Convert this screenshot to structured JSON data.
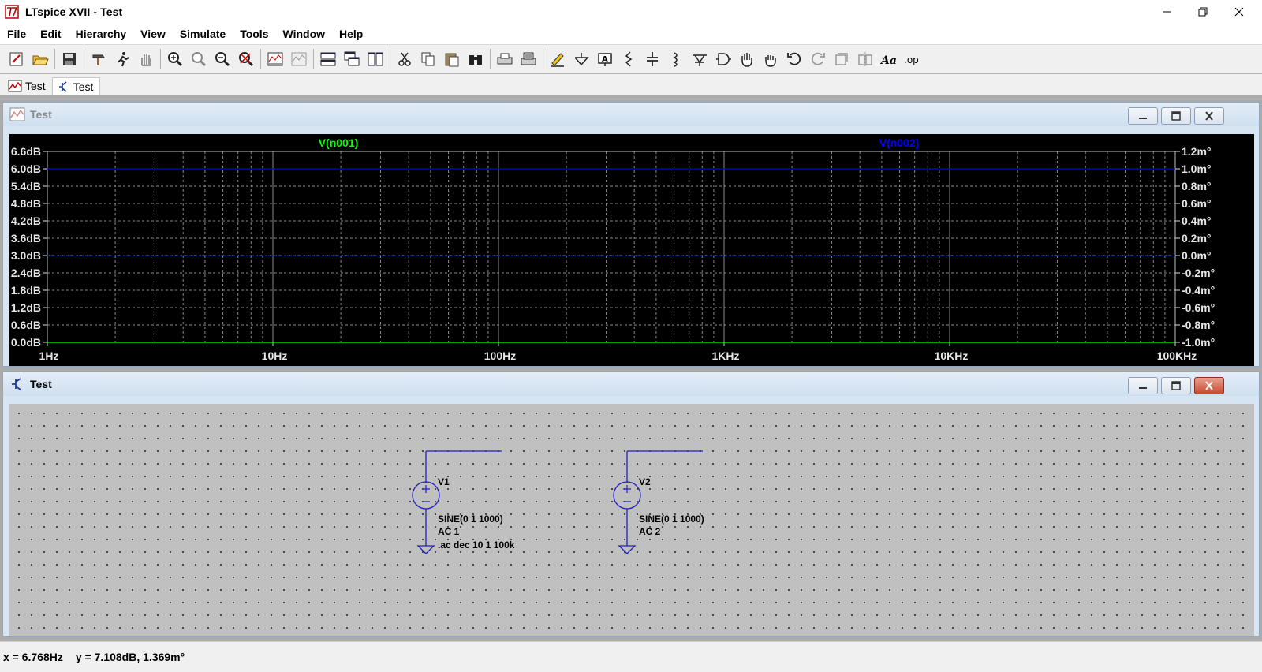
{
  "window": {
    "title": "LTspice XVII - Test"
  },
  "menu": [
    "File",
    "Edit",
    "Hierarchy",
    "View",
    "Simulate",
    "Tools",
    "Window",
    "Help"
  ],
  "doc_tabs": [
    {
      "label": "Test",
      "icon": "waveform-icon",
      "active": false
    },
    {
      "label": "Test",
      "icon": "schematic-icon",
      "active": true
    }
  ],
  "waveform_window": {
    "title": "Test",
    "traces": [
      {
        "name": "V(n001)",
        "color": "#00ff00"
      },
      {
        "name": "V(n002)",
        "color": "#0000ff"
      }
    ],
    "left_axis": [
      "6.6dB",
      "6.0dB",
      "5.4dB",
      "4.8dB",
      "4.2dB",
      "3.6dB",
      "3.0dB",
      "2.4dB",
      "1.8dB",
      "1.2dB",
      "0.6dB",
      "0.0dB"
    ],
    "right_axis": [
      "1.2m°",
      "1.0m°",
      "0.8m°",
      "0.6m°",
      "0.4m°",
      "0.2m°",
      "0.0m°",
      "-0.2m°",
      "-0.4m°",
      "-0.6m°",
      "-0.8m°",
      "-1.0m°"
    ],
    "x_axis": [
      "1Hz",
      "10Hz",
      "100Hz",
      "1KHz",
      "10KHz",
      "100KHz"
    ]
  },
  "chart_data": {
    "type": "line",
    "x_scale": "log",
    "xlim": [
      "1Hz",
      "100KHz"
    ],
    "ylim_left_dB": [
      0.0,
      6.6
    ],
    "ylim_right_mdeg": [
      -1.0,
      1.2
    ],
    "series": [
      {
        "name": "V(n001)",
        "magnitude_dB": 0.0,
        "phase_mdeg": 0.0
      },
      {
        "name": "V(n002)",
        "magnitude_dB": 6.0,
        "phase_mdeg": 0.0
      }
    ]
  },
  "schematic_window": {
    "title": "Test",
    "components": [
      {
        "ref": "V1",
        "value": "SINE(0 1 1000)",
        "ac": "AC 1",
        "directive": ".ac dec 10 1 100k"
      },
      {
        "ref": "V2",
        "value": "SINE(0 1 1000)",
        "ac": "AC 2",
        "directive": ""
      }
    ]
  },
  "status": {
    "x": "x = 6.768Hz",
    "y": "y = 7.108dB, 1.369m°"
  },
  "colors": {
    "wire": "#2020c0",
    "grid": "#8a8a8a",
    "plot_bg": "#000000",
    "schem_bg": "#c0c0c0"
  }
}
